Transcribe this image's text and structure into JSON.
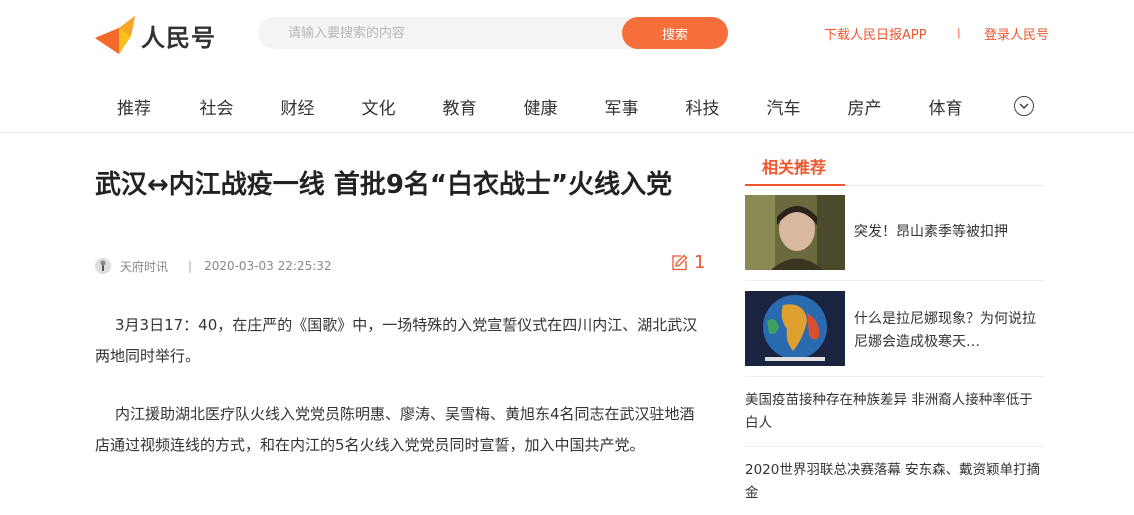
{
  "header": {
    "logo_text": "人民号",
    "search_placeholder": "请输入要搜索的内容",
    "search_button": "搜索",
    "download_link": "下载人民日报APP",
    "separator": "|",
    "login_link": "登录人民号",
    "accent_color": "#f0552d"
  },
  "nav": {
    "items": [
      "推荐",
      "社会",
      "财经",
      "文化",
      "教育",
      "健康",
      "军事",
      "科技",
      "汽车",
      "房产",
      "体育"
    ],
    "more_icon": "chevron-down-circle-icon"
  },
  "article": {
    "title": "武汉↔内江战疫一线 首批9名“白衣战士”火线入党",
    "source": "天府时讯",
    "separator": "|",
    "datetime": "2020-03-03 22:25:32",
    "comment_count": "1",
    "paragraphs": [
      "3月3日17：40，在庄严的《国歌》中，一场特殊的入党宣誓仪式在四川内江、湖北武汉两地同时举行。",
      "内江援助湖北医疗队火线入党党员陈明惠、廖涛、吴雪梅、黄旭东4名同志在武汉驻地酒店通过视频连线的方式，和在内江的5名火线入党党员同时宣誓，加入中国共产党。"
    ]
  },
  "sidebar": {
    "title": "相关推荐",
    "items": [
      {
        "text": "突发！昂山素季等被扣押",
        "has_image": true
      },
      {
        "text": "什么是拉尼娜现象？为何说拉尼娜会造成极寒天…",
        "has_image": true
      },
      {
        "text": "美国疫苗接种存在种族差异 非洲裔人接种率低于白人",
        "has_image": false
      },
      {
        "text": "2020世界羽联总决赛落幕 安东森、戴资颖单打摘金",
        "has_image": false
      }
    ]
  }
}
